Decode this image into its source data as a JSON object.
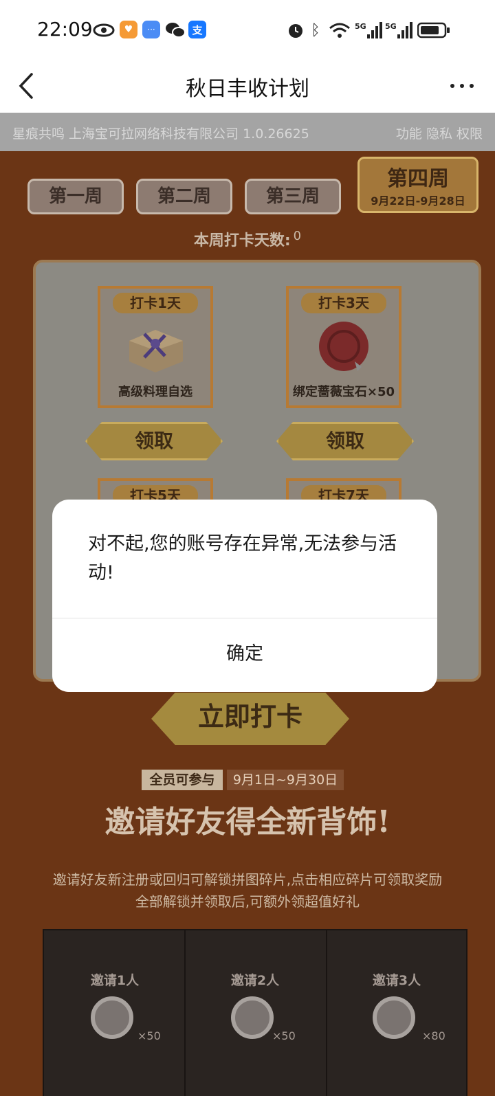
{
  "status_bar": {
    "time": "22:09",
    "net1": "5G",
    "net2": "5G"
  },
  "nav": {
    "title": "秋日丰收计划"
  },
  "info_strip": {
    "left_text": "星痕共鸣 上海宝可拉网络科技有限公司 1.0.26625",
    "right_text": "功能 隐私 权限"
  },
  "weeks": {
    "tabs": [
      "第一周",
      "第二周",
      "第三周"
    ],
    "active_label": "第四周",
    "active_dates": "9月22日-9月28日"
  },
  "checkin": {
    "label": "本周打卡天数:",
    "count": "0"
  },
  "rewards": [
    {
      "tag": "打卡1天",
      "name": "高级料理自选",
      "claim": "领取"
    },
    {
      "tag": "打卡3天",
      "name": "绑定蔷薇宝石×50",
      "claim": "领取"
    },
    {
      "tag": "打卡5天"
    },
    {
      "tag": "打卡7天"
    }
  ],
  "checkin_button": "立即打卡",
  "invite": {
    "badge_all": "全员可参与",
    "badge_date": "9月1日~9月30日",
    "title": "邀请好友得全新背饰!",
    "desc_line1": "邀请好友新注册或回归可解锁拼图碎片,点击相应碎片可领取奖励",
    "desc_line2": "全部解锁并领取后,可额外领超值好礼",
    "pieces": [
      {
        "label": "邀请1人",
        "qty": "×50"
      },
      {
        "label": "邀请2人",
        "qty": "×50"
      },
      {
        "label": "邀请3人",
        "qty": "×80"
      }
    ]
  },
  "dialog": {
    "message": "对不起,您的账号存在异常,无法参与活动!",
    "confirm": "确定"
  },
  "colors": {
    "accent": "#a48a3e",
    "background": "#6b3515"
  }
}
